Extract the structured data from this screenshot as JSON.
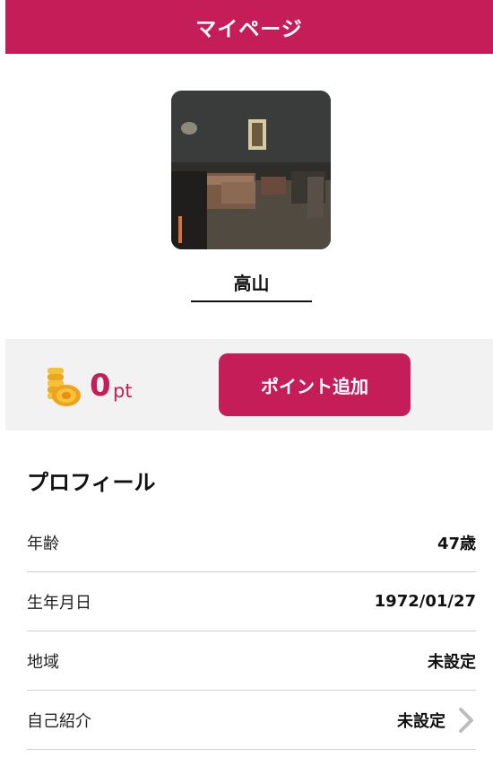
{
  "header": {
    "title": "マイページ"
  },
  "user": {
    "name": "高山",
    "avatar_icon": "profile-photo"
  },
  "points": {
    "value": "0",
    "unit": "pt",
    "icon": "coin-stack-icon",
    "add_label": "ポイント追加"
  },
  "profile": {
    "title": "プロフィール",
    "rows": [
      {
        "label": "年齢",
        "value": "47歳"
      },
      {
        "label": "生年月日",
        "value": "1972/01/27"
      },
      {
        "label": "地域",
        "value": "未設定"
      },
      {
        "label": "自己紹介",
        "value": "未設定"
      }
    ]
  },
  "colors": {
    "accent": "#c41d57",
    "panel": "#f2f2f2",
    "divider": "#cfcfcf"
  }
}
